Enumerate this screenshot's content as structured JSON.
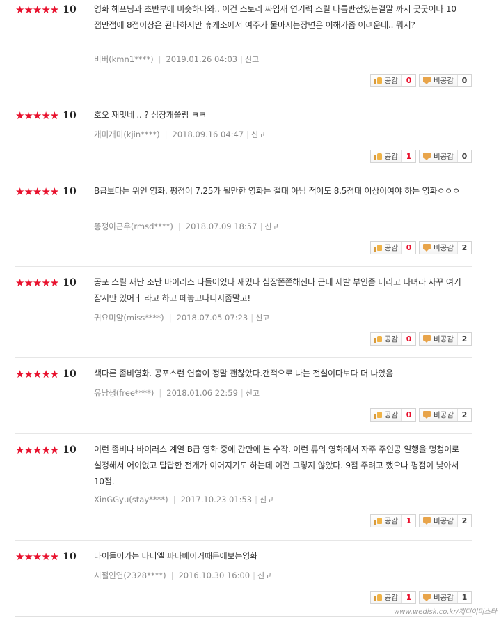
{
  "ui": {
    "like_label": "공감",
    "dislike_label": "비공감",
    "report_label": "신고",
    "stars": "★★★★★",
    "sep": "|"
  },
  "reviews": [
    {
      "score": "10",
      "text": "영화 헤프닝과 초반부에 비슷하나와.. 이건 스토리 짜임새 연기력 스릴 나름반전있는걸말 까지 굿굿이다 10점만점에 8점이상은 된다하지만 휴게소에서 여주가 물마시는장면은 이해가좀 어려운데.. 뭐지?",
      "author": "비버(kmn1****)",
      "date": "2019.01.26 04:03",
      "likes": "0",
      "dislikes": "0"
    },
    {
      "score": "10",
      "text": "호오 재밋네 .. ? 심장개쫄림 ㅋㅋ",
      "author": "개미개미(kjin****)",
      "date": "2018.09.16 04:47",
      "likes": "1",
      "dislikes": "0"
    },
    {
      "score": "10",
      "text": "B급보다는 위인 영화. 평점이 7.25가 될만한 영화는 절대 아님 적어도 8.5점대 이상이여야 하는 영화ㅇㅇㅇ",
      "author": "똥쟁이근우(rmsd****)",
      "date": "2018.07.09 18:57",
      "likes": "0",
      "dislikes": "2"
    },
    {
      "score": "10",
      "text": "공포 스릴 재난 조난 바이러스 다들어있다 재밌다 심장쫀쫀해진다 근데 제발 부인좀 데리고 다녀라 자꾸 여기잠시만 있어ㅓ 라고 하고 떼놓고다니지좀말고!",
      "author": "귀요미얌(miss****)",
      "date": "2018.07.05 07:23",
      "likes": "0",
      "dislikes": "2"
    },
    {
      "score": "10",
      "text": "색다른 좀비영화. 공포스런 연출이 정말 괜찮았다.갠적으로 나는 전설이다보다 더 나았음",
      "author": "유남생(free****)",
      "date": "2018.01.06 22:59",
      "likes": "0",
      "dislikes": "2"
    },
    {
      "score": "10",
      "text": "이런 좀비나 바이러스 계열 B급 영화 중에 간만에 본 수작. 이런 류의 영화에서 자주 주인공 일행을 멍청이로 설정해서 어이없고 답답한 전개가 이어지기도 하는데 이건 그렇지 않았다. 9점 주려고 했으나 평점이 낮아서 10점.",
      "author": "XinGGyu(stay****)",
      "date": "2017.10.23 01:53",
      "likes": "1",
      "dislikes": "2"
    },
    {
      "score": "10",
      "text": "나이들어가는 다니엘 파나베이커때문에보는영화",
      "author": "시절인연(2328****)",
      "date": "2016.10.30 16:00",
      "likes": "1",
      "dislikes": "1"
    }
  ],
  "watermark": "www.wedisk.co.kr/제디이미스타"
}
